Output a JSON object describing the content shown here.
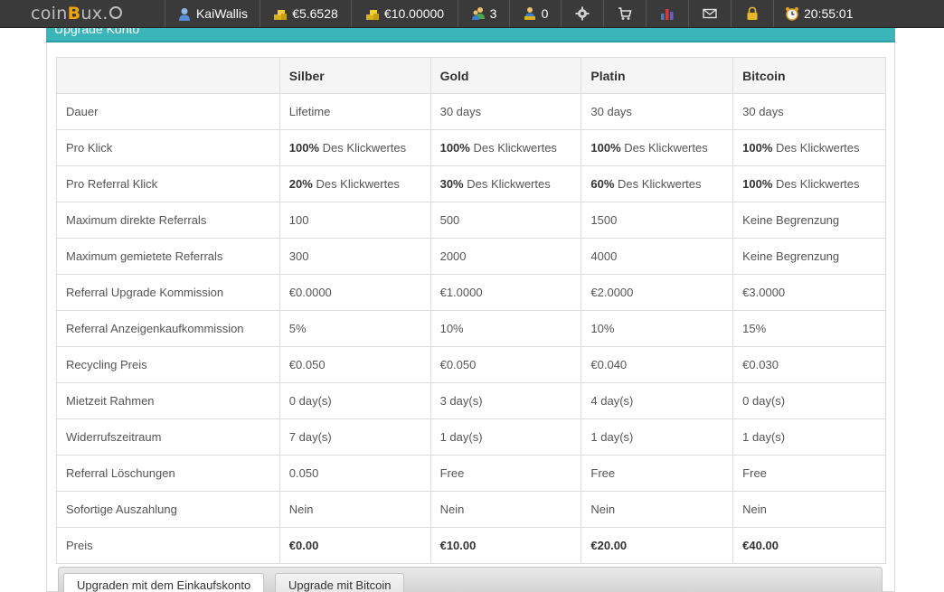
{
  "topbar": {
    "logo_pre": "coin",
    "logo_b": "B",
    "logo_post": "ux.",
    "username": "KaiWallis",
    "balance_main": "€5.6528",
    "balance_purchase": "€10.00000",
    "direct_refs": "3",
    "rented_refs": "0",
    "time": "20:55:01"
  },
  "banner": {
    "title": "Upgrade Konto"
  },
  "table": {
    "headers": [
      "",
      "Silber",
      "Gold",
      "Platin",
      "Bitcoin"
    ],
    "rows": [
      {
        "label": "Dauer",
        "cells": [
          "Lifetime",
          "30 days",
          "30 days",
          "30 days"
        ]
      },
      {
        "label": "Pro Klick",
        "bold": [
          "100%",
          "100%",
          "100%",
          "100%"
        ],
        "suffix": "Des Klickwertes"
      },
      {
        "label": "Pro Referral Klick",
        "bold": [
          "20%",
          "30%",
          "60%",
          "100%"
        ],
        "suffix": "Des Klickwertes"
      },
      {
        "label": "Maximum direkte Referrals",
        "cells": [
          "100",
          "500",
          "1500",
          "Keine Begrenzung"
        ]
      },
      {
        "label": "Maximum gemietete Referrals",
        "cells": [
          "300",
          "2000",
          "4000",
          "Keine Begrenzung"
        ]
      },
      {
        "label": "Referral Upgrade Kommission",
        "cells": [
          "€0.0000",
          "€1.0000",
          "€2.0000",
          "€3.0000"
        ]
      },
      {
        "label": "Referral Anzeigenkaufkommission",
        "cells": [
          "5%",
          "10%",
          "10%",
          "15%"
        ]
      },
      {
        "label": "Recycling Preis",
        "cells": [
          "€0.050",
          "€0.050",
          "€0.040",
          "€0.030"
        ]
      },
      {
        "label": "Mietzeit Rahmen",
        "cells": [
          "0 day(s)",
          "3 day(s)",
          "4 day(s)",
          "0 day(s)"
        ]
      },
      {
        "label": "Widerrufszeitraum",
        "cells": [
          "7 day(s)",
          "1 day(s)",
          "1 day(s)",
          "1 day(s)"
        ]
      },
      {
        "label": "Referral Löschungen",
        "cells": [
          "0.050",
          "Free",
          "Free",
          "Free"
        ]
      },
      {
        "label": "Sofortige Auszahlung",
        "cells": [
          "Nein",
          "Nein",
          "Nein",
          "Nein"
        ]
      },
      {
        "label": "Preis",
        "cells": [
          "€0.00",
          "€10.00",
          "€20.00",
          "€40.00"
        ]
      }
    ]
  },
  "tabs": {
    "purchase": "Upgraden mit dem Einkaufskonto",
    "bitcoin": "Upgrade mit Bitcoin"
  },
  "colors": {
    "topbar": "#3a3a3a",
    "accent": "#3ab5ba",
    "logo_b": "#f0a400"
  }
}
